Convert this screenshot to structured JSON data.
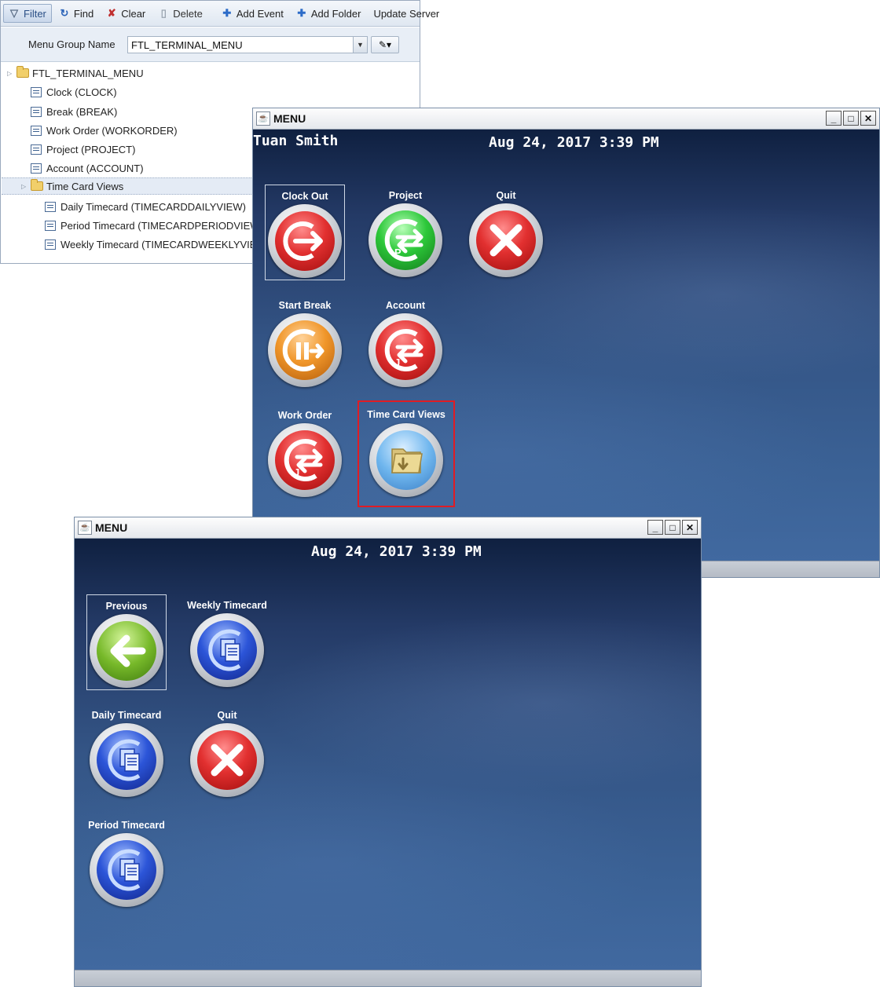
{
  "toolbar": {
    "filter": "Filter",
    "find": "Find",
    "clear": "Clear",
    "delete": "Delete",
    "add_event": "Add Event",
    "add_folder": "Add Folder",
    "update_server": "Update Server"
  },
  "form": {
    "menu_group_label": "Menu Group Name",
    "menu_group_value": "FTL_TERMINAL_MENU"
  },
  "tree": {
    "root": "FTL_TERMINAL_MENU",
    "items": [
      "Clock (CLOCK)",
      "Break (BREAK)",
      "Work Order (WORKORDER)",
      "Project (PROJECT)",
      "Account (ACCOUNT)"
    ],
    "folder": "Time Card Views",
    "children": [
      "Daily Timecard (TIMECARDDAILYVIEW)",
      "Period Timecard (TIMECARDPERIODVIEW)",
      "Weekly Timecard (TIMECARDWEEKLYVIEW)"
    ]
  },
  "main_menu": {
    "title": "MENU",
    "user": "Tuan Smith",
    "datetime": "Aug 24, 2017 3:39 PM",
    "buttons": {
      "clock_out": "Clock Out",
      "project": "Project",
      "quit": "Quit",
      "start_break": "Start Break",
      "account": "Account",
      "work_order": "Work Order",
      "time_card_views": "Time Card Views"
    }
  },
  "sub_menu": {
    "title": "MENU",
    "datetime": "Aug 24, 2017 3:39 PM",
    "buttons": {
      "previous": "Previous",
      "weekly": "Weekly Timecard",
      "daily": "Daily Timecard",
      "quit": "Quit",
      "period": "Period Timecard"
    }
  },
  "window_controls": {
    "minimize": "_",
    "maximize": "□",
    "close": "✕"
  },
  "icons": {
    "clock_out": "clock-out-arrow-icon",
    "project": "transfer-arrows-icon",
    "quit": "x-icon",
    "break": "pause-arrow-icon",
    "account": "transfer-arrows-icon",
    "work_order": "transfer-arrows-icon",
    "folder": "folder-icon",
    "previous": "left-arrow-icon",
    "timecard": "document-copy-icon"
  },
  "colors": {
    "accent_red": "#e01c24",
    "terminal_bg": "#3d5f8e"
  }
}
